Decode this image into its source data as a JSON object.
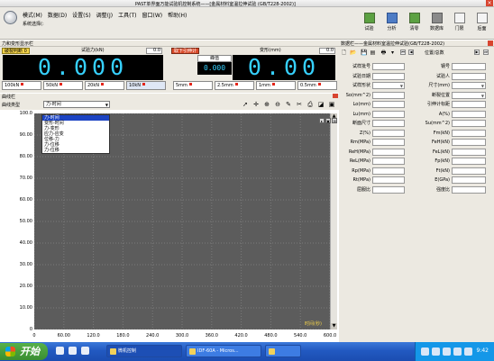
{
  "window": {
    "title": "PAST单界面万能试验机控制系统——[金属材料室温拉伸试验 (GB/T228-2002)]"
  },
  "menu": {
    "items": [
      "模式(M)",
      "数据(D)",
      "设置(S)",
      "调整(J)",
      "工具(T)",
      "窗口(W)",
      "帮助(H)"
    ],
    "system_mode": "系统选择(:"
  },
  "toolbar_right": {
    "items": [
      {
        "label": "试验",
        "icon": "run-test-icon"
      },
      {
        "label": "分析",
        "icon": "analyze-icon"
      },
      {
        "label": "清零",
        "icon": "zero-icon"
      },
      {
        "label": "数据库",
        "icon": "database-icon"
      },
      {
        "label": "门限",
        "icon": "threshold-icon"
      },
      {
        "label": "后面",
        "icon": "next-icon"
      }
    ]
  },
  "readout_panel": {
    "title": "力和变形显示栏",
    "force": {
      "label": "试验力(kN)",
      "value": "0.000",
      "unit_value": "0.0",
      "tag": "破裂判断 0"
    },
    "peak": {
      "label": "峰值",
      "value": "0.000"
    },
    "displacement": {
      "label": "变形(mm)",
      "value": "0.00",
      "unit_value": "0.0",
      "tag": "取下引伸计"
    },
    "range_buttons": [
      "100kN",
      "50kN",
      "20kN",
      "10kN",
      "5mm",
      "2.5mm",
      "1mm",
      "0.5mm"
    ],
    "selected_range": "10kN"
  },
  "curve_panel": {
    "title": "曲线栏",
    "type_label": "曲线类型",
    "type_value": "力-时间",
    "type_options": [
      "力-时间",
      "变形-时间",
      "力-变形",
      "应力-应变",
      "位移-力",
      "力-位移",
      "力-位移"
    ],
    "x_axis_label": "时间(秒)",
    "toolbar_icons": [
      "pointer-icon",
      "crosshair-icon",
      "zoom-in-icon",
      "zoom-out-icon",
      "pen-icon",
      "cut-icon",
      "print-icon",
      "curve-icon",
      "save-icon"
    ]
  },
  "chart_data": {
    "type": "line",
    "xlabel": "时间(秒)",
    "ylabel": "",
    "x_ticks": [
      "0",
      "60.00",
      "120.0",
      "180.0",
      "240.0",
      "300.0",
      "360.0",
      "420.0",
      "480.0",
      "540.0",
      "600.0"
    ],
    "y_ticks": [
      "0",
      "10.00",
      "20.00",
      "30.00",
      "40.00",
      "50.00",
      "60.00",
      "70.00",
      "80.00",
      "90.00",
      "100.0"
    ],
    "xlim": [
      0,
      600
    ],
    "ylim": [
      0,
      100
    ],
    "series": [],
    "grid": true
  },
  "right_panel": {
    "title": "数据栏——金属材料室温拉伸试验(GB/T228-2002)",
    "position_label": "位置/总数",
    "fields_left": [
      "试样批号",
      "试验日期",
      "试样形状",
      "So(mm^2)",
      "Lo(mm)",
      "Lu(mm)",
      "断面尺寸",
      "Z(%)",
      "Rm(MPa)",
      "ReH(MPa)",
      "ReL(MPa)",
      "Rp(MPa)",
      "Rt(MPa)",
      "屈服比"
    ],
    "fields_right": [
      "钢号",
      "试验人",
      "尺寸(mm)",
      "断裂位置",
      "引伸计标距",
      "A(%)",
      "Su(mm^2)",
      "Fm(kN)",
      "FeH(kN)",
      "FeL(kN)",
      "Fp(kN)",
      "Ft(kN)",
      "E(GPa)",
      "强度比"
    ]
  },
  "taskbar": {
    "start_label": "开始",
    "tasks": [
      "微机控制",
      "IDF-60A - Micros...",
      ""
    ],
    "clock": "9:42"
  }
}
